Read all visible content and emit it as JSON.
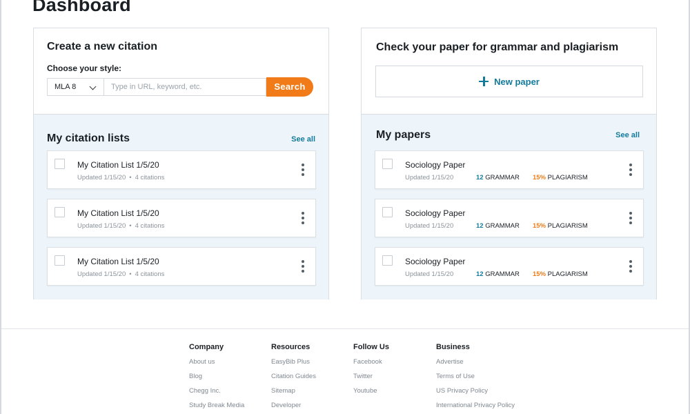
{
  "page": {
    "title": "Dashboard"
  },
  "colors": {
    "accent_orange": "#f07b18",
    "accent_teal": "#137a9c",
    "panel_bg": "#eef5fa"
  },
  "citation_card": {
    "heading": "Create a new citation",
    "style_label": "Choose your style:",
    "style_value": "MLA 8",
    "url_placeholder": "Type in URL, keyword, etc.",
    "search_label": "Search"
  },
  "citation_lists": {
    "title": "My citation lists",
    "see_all": "See all",
    "items": [
      {
        "title": "My Citation List 1/5/20",
        "updated": "Updated 1/15/20",
        "count": "4 citations"
      },
      {
        "title": "My Citation List 1/5/20",
        "updated": "Updated 1/15/20",
        "count": "4 citations"
      },
      {
        "title": "My Citation List 1/5/20",
        "updated": "Updated 1/15/20",
        "count": "4 citations"
      }
    ]
  },
  "paper_card": {
    "heading": "Check your paper for grammar and plagiarism",
    "new_paper_label": "New paper"
  },
  "papers": {
    "title": "My papers",
    "see_all": "See all",
    "items": [
      {
        "title": "Sociology Paper",
        "updated": "Updated 1/15/20",
        "grammar_num": "12",
        "grammar_label": "GRAMMAR",
        "plag_num": "15%",
        "plag_label": "PLAGIARISM"
      },
      {
        "title": "Sociology Paper",
        "updated": "Updated 1/15/20",
        "grammar_num": "12",
        "grammar_label": "GRAMMAR",
        "plag_num": "15%",
        "plag_label": "PLAGIARISM"
      },
      {
        "title": "Sociology Paper",
        "updated": "Updated 1/15/20",
        "grammar_num": "12",
        "grammar_label": "GRAMMAR",
        "plag_num": "15%",
        "plag_label": "PLAGIARISM"
      }
    ]
  },
  "footer": {
    "columns": [
      {
        "heading": "Company",
        "links": [
          "About us",
          "Blog",
          "Chegg Inc.",
          "Study Break Media"
        ]
      },
      {
        "heading": "Resources",
        "links": [
          "EasyBib Plus",
          "Citation Guides",
          "Sitemap",
          "Developer"
        ]
      },
      {
        "heading": "Follow Us",
        "links": [
          "Facebook",
          "Twitter",
          "Youtube"
        ]
      },
      {
        "heading": "Business",
        "links": [
          "Advertise",
          "Terms of Use",
          "US Privacy Policy",
          "International Privacy Policy"
        ]
      }
    ]
  }
}
